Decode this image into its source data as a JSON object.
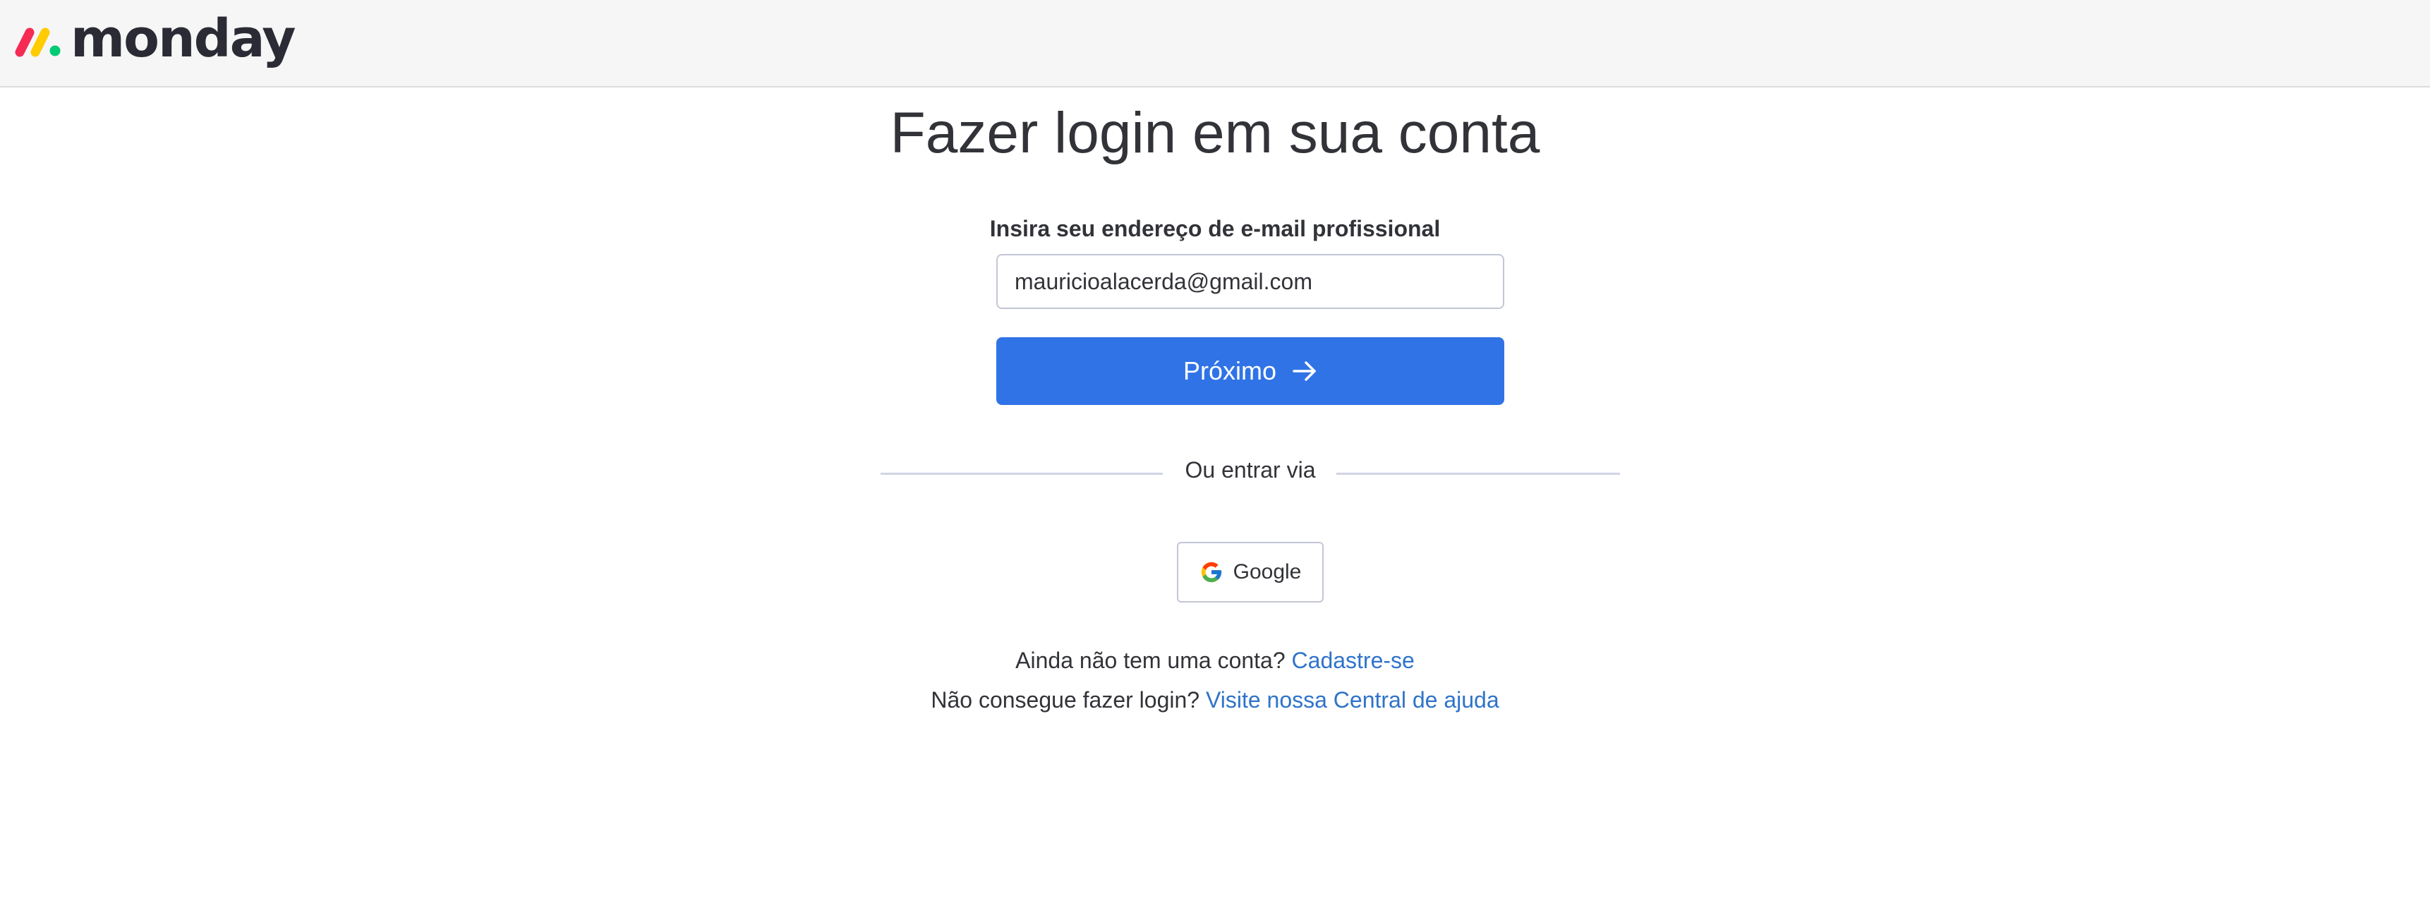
{
  "brand": {
    "name": "monday",
    "colors": {
      "red": "#f62b54",
      "yellow": "#ffcc00",
      "green": "#00ca72",
      "accent": "#3073e6",
      "link": "#2f73ca"
    }
  },
  "page": {
    "title": "Fazer login em sua conta"
  },
  "form": {
    "email_label": "Insira seu endereço de e-mail profissional",
    "email_value": "mauricioalacerda@gmail.com",
    "next_label": "Próximo",
    "next_icon": "arrow-right-icon"
  },
  "alt_login": {
    "divider_text": "Ou entrar via",
    "google_label": "Google",
    "google_icon": "google-icon"
  },
  "footer": {
    "signup_prompt": "Ainda não tem uma conta?",
    "signup_link": "Cadastre-se",
    "help_prompt": "Não consegue fazer login?",
    "help_link": "Visite nossa Central de ajuda"
  }
}
